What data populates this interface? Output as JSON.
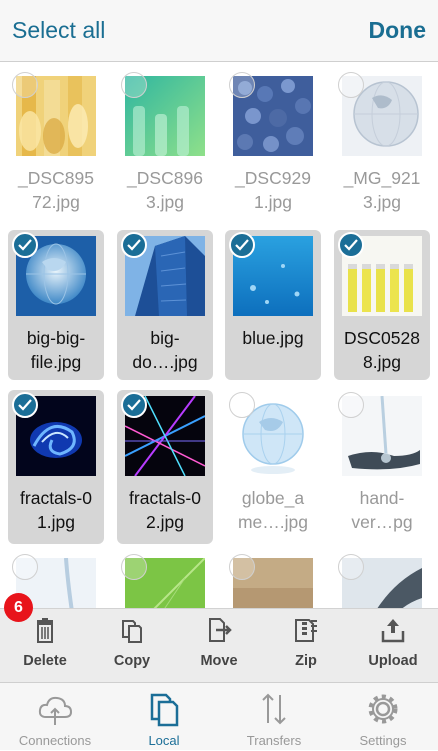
{
  "header": {
    "select_all": "Select all",
    "done": "Done"
  },
  "files": [
    {
      "label": "_DSC895\n72.jpg",
      "selected": false
    },
    {
      "label": "_DSC896\n3.jpg",
      "selected": false
    },
    {
      "label": "_DSC929\n1.jpg",
      "selected": false
    },
    {
      "label": "_MG_921\n3.jpg",
      "selected": false
    },
    {
      "label": "big-big-\nfile.jpg",
      "selected": true
    },
    {
      "label": "big-\ndo….jpg",
      "selected": true
    },
    {
      "label": "blue.jpg",
      "selected": true
    },
    {
      "label": "DSC0528\n8.jpg",
      "selected": true
    },
    {
      "label": "fractals-0\n1.jpg",
      "selected": true
    },
    {
      "label": "fractals-0\n2.jpg",
      "selected": true
    },
    {
      "label": "globe_a\nme….jpg",
      "selected": false
    },
    {
      "label": "hand-\nver…pg",
      "selected": false
    }
  ],
  "selection_count": "6",
  "toolbar": {
    "delete": "Delete",
    "copy": "Copy",
    "move": "Move",
    "zip": "Zip",
    "upload": "Upload"
  },
  "tabs": {
    "connections": "Connections",
    "local": "Local",
    "transfers": "Transfers",
    "settings": "Settings"
  },
  "colors": {
    "accent": "#1b6e97",
    "badge": "#e8141b"
  }
}
